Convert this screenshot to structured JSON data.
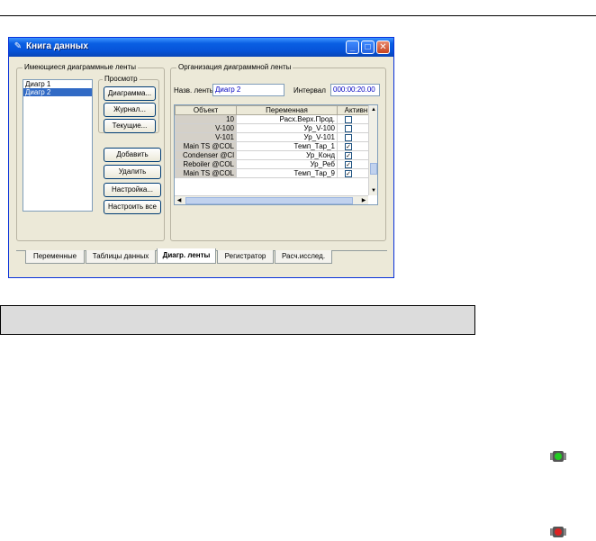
{
  "window": {
    "title": "Книга данных",
    "buttons": {
      "minimize": "_",
      "maximize": "□",
      "close": "✕"
    }
  },
  "left_group": {
    "title": "Имеющиеся диаграммные ленты",
    "items": [
      "Диагр 1",
      "Диагр 2"
    ],
    "selected_index": 1
  },
  "view_group": {
    "title": "Просмотр",
    "buttons": [
      "Диаграмма...",
      "Журнал...",
      "Текущие..."
    ]
  },
  "actions": [
    "Добавить",
    "Удалить",
    "Настройка...",
    "Настроить все"
  ],
  "right_group": {
    "title": "Организация диаграммной ленты",
    "name_label": "Назв. ленты",
    "name_value": "Диагр 2",
    "interval_label": "Интервал",
    "interval_value": "000:00:20.00"
  },
  "grid": {
    "headers": [
      "Объект",
      "Переменная",
      "Активн"
    ],
    "rows": [
      {
        "object": "10",
        "variable": "Расх.Верх.Прод.",
        "active": false
      },
      {
        "object": "V-100",
        "variable": "Ур_V-100",
        "active": false
      },
      {
        "object": "V-101",
        "variable": "Ур_V-101",
        "active": false
      },
      {
        "object": "Main TS @COL",
        "variable": "Темп_Тар_1",
        "active": true
      },
      {
        "object": "Condenser @Cl",
        "variable": "Ур_Конд",
        "active": true
      },
      {
        "object": "Reboiler @COL",
        "variable": "Ур_Реб",
        "active": true
      },
      {
        "object": "Main TS @COL",
        "variable": "Темп_Тар_9",
        "active": true
      }
    ]
  },
  "tabs": [
    {
      "label": "Переменные",
      "active": false
    },
    {
      "label": "Таблицы данных",
      "active": false
    },
    {
      "label": "Диагр. ленты",
      "active": true
    },
    {
      "label": "Регистратор",
      "active": false
    },
    {
      "label": "Расч.исслед.",
      "active": false
    }
  ],
  "icons": {
    "traffic_green": "traffic-light-green-icon",
    "traffic_red": "traffic-light-red-icon",
    "green": "#22cc22",
    "red": "#dd2222"
  }
}
